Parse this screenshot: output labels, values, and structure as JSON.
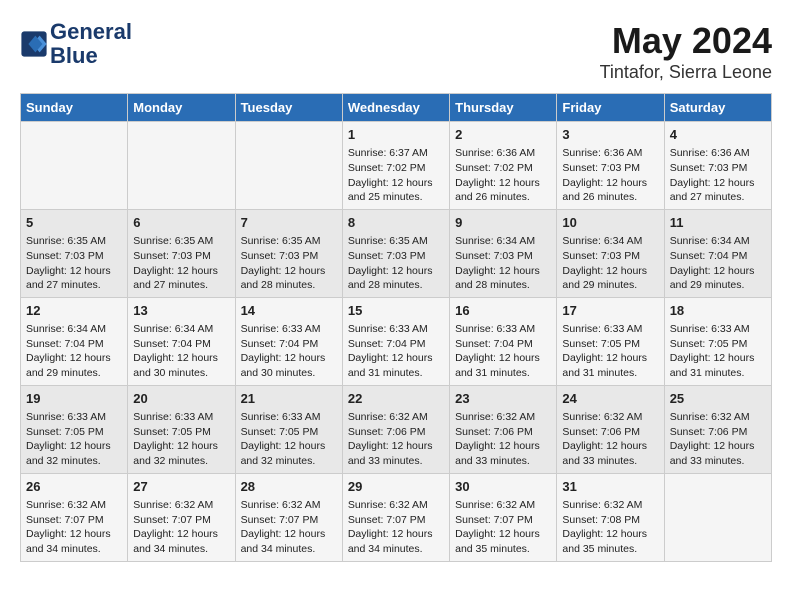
{
  "header": {
    "logo_line1": "General",
    "logo_line2": "Blue",
    "month_year": "May 2024",
    "location": "Tintafor, Sierra Leone"
  },
  "days_of_week": [
    "Sunday",
    "Monday",
    "Tuesday",
    "Wednesday",
    "Thursday",
    "Friday",
    "Saturday"
  ],
  "weeks": [
    [
      {
        "day": "",
        "content": ""
      },
      {
        "day": "",
        "content": ""
      },
      {
        "day": "",
        "content": ""
      },
      {
        "day": "1",
        "content": "Sunrise: 6:37 AM\nSunset: 7:02 PM\nDaylight: 12 hours\nand 25 minutes."
      },
      {
        "day": "2",
        "content": "Sunrise: 6:36 AM\nSunset: 7:02 PM\nDaylight: 12 hours\nand 26 minutes."
      },
      {
        "day": "3",
        "content": "Sunrise: 6:36 AM\nSunset: 7:03 PM\nDaylight: 12 hours\nand 26 minutes."
      },
      {
        "day": "4",
        "content": "Sunrise: 6:36 AM\nSunset: 7:03 PM\nDaylight: 12 hours\nand 27 minutes."
      }
    ],
    [
      {
        "day": "5",
        "content": "Sunrise: 6:35 AM\nSunset: 7:03 PM\nDaylight: 12 hours\nand 27 minutes."
      },
      {
        "day": "6",
        "content": "Sunrise: 6:35 AM\nSunset: 7:03 PM\nDaylight: 12 hours\nand 27 minutes."
      },
      {
        "day": "7",
        "content": "Sunrise: 6:35 AM\nSunset: 7:03 PM\nDaylight: 12 hours\nand 28 minutes."
      },
      {
        "day": "8",
        "content": "Sunrise: 6:35 AM\nSunset: 7:03 PM\nDaylight: 12 hours\nand 28 minutes."
      },
      {
        "day": "9",
        "content": "Sunrise: 6:34 AM\nSunset: 7:03 PM\nDaylight: 12 hours\nand 28 minutes."
      },
      {
        "day": "10",
        "content": "Sunrise: 6:34 AM\nSunset: 7:03 PM\nDaylight: 12 hours\nand 29 minutes."
      },
      {
        "day": "11",
        "content": "Sunrise: 6:34 AM\nSunset: 7:04 PM\nDaylight: 12 hours\nand 29 minutes."
      }
    ],
    [
      {
        "day": "12",
        "content": "Sunrise: 6:34 AM\nSunset: 7:04 PM\nDaylight: 12 hours\nand 29 minutes."
      },
      {
        "day": "13",
        "content": "Sunrise: 6:34 AM\nSunset: 7:04 PM\nDaylight: 12 hours\nand 30 minutes."
      },
      {
        "day": "14",
        "content": "Sunrise: 6:33 AM\nSunset: 7:04 PM\nDaylight: 12 hours\nand 30 minutes."
      },
      {
        "day": "15",
        "content": "Sunrise: 6:33 AM\nSunset: 7:04 PM\nDaylight: 12 hours\nand 31 minutes."
      },
      {
        "day": "16",
        "content": "Sunrise: 6:33 AM\nSunset: 7:04 PM\nDaylight: 12 hours\nand 31 minutes."
      },
      {
        "day": "17",
        "content": "Sunrise: 6:33 AM\nSunset: 7:05 PM\nDaylight: 12 hours\nand 31 minutes."
      },
      {
        "day": "18",
        "content": "Sunrise: 6:33 AM\nSunset: 7:05 PM\nDaylight: 12 hours\nand 31 minutes."
      }
    ],
    [
      {
        "day": "19",
        "content": "Sunrise: 6:33 AM\nSunset: 7:05 PM\nDaylight: 12 hours\nand 32 minutes."
      },
      {
        "day": "20",
        "content": "Sunrise: 6:33 AM\nSunset: 7:05 PM\nDaylight: 12 hours\nand 32 minutes."
      },
      {
        "day": "21",
        "content": "Sunrise: 6:33 AM\nSunset: 7:05 PM\nDaylight: 12 hours\nand 32 minutes."
      },
      {
        "day": "22",
        "content": "Sunrise: 6:32 AM\nSunset: 7:06 PM\nDaylight: 12 hours\nand 33 minutes."
      },
      {
        "day": "23",
        "content": "Sunrise: 6:32 AM\nSunset: 7:06 PM\nDaylight: 12 hours\nand 33 minutes."
      },
      {
        "day": "24",
        "content": "Sunrise: 6:32 AM\nSunset: 7:06 PM\nDaylight: 12 hours\nand 33 minutes."
      },
      {
        "day": "25",
        "content": "Sunrise: 6:32 AM\nSunset: 7:06 PM\nDaylight: 12 hours\nand 33 minutes."
      }
    ],
    [
      {
        "day": "26",
        "content": "Sunrise: 6:32 AM\nSunset: 7:07 PM\nDaylight: 12 hours\nand 34 minutes."
      },
      {
        "day": "27",
        "content": "Sunrise: 6:32 AM\nSunset: 7:07 PM\nDaylight: 12 hours\nand 34 minutes."
      },
      {
        "day": "28",
        "content": "Sunrise: 6:32 AM\nSunset: 7:07 PM\nDaylight: 12 hours\nand 34 minutes."
      },
      {
        "day": "29",
        "content": "Sunrise: 6:32 AM\nSunset: 7:07 PM\nDaylight: 12 hours\nand 34 minutes."
      },
      {
        "day": "30",
        "content": "Sunrise: 6:32 AM\nSunset: 7:07 PM\nDaylight: 12 hours\nand 35 minutes."
      },
      {
        "day": "31",
        "content": "Sunrise: 6:32 AM\nSunset: 7:08 PM\nDaylight: 12 hours\nand 35 minutes."
      },
      {
        "day": "",
        "content": ""
      }
    ]
  ]
}
